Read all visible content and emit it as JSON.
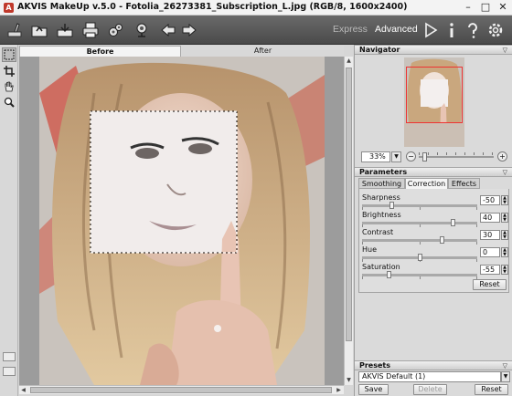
{
  "window": {
    "title": "AKVIS MakeUp v.5.0 - Fotolia_26273381_Subscription_L.jpg (RGB/8, 1600x2400)",
    "logo_letter": "A",
    "minimize": "–",
    "maximize": "□",
    "close": "✕"
  },
  "toolbar": {
    "icons": [
      "open-image-icon",
      "save-image-icon",
      "print-icon",
      "plugins-icon",
      "batch-icon",
      "undo-icon",
      "redo-icon",
      "run-icon",
      "info-icon",
      "help-icon",
      "preferences-icon"
    ],
    "mode_express": "Express",
    "mode_advanced": "Advanced",
    "active_mode": "Advanced"
  },
  "left_tools": [
    "selection-tool-icon",
    "crop-tool-icon",
    "hand-tool-icon",
    "zoom-tool-icon"
  ],
  "canvas": {
    "tab_before": "Before",
    "tab_after": "After",
    "active_tab": "Before"
  },
  "navigator": {
    "title": "Navigator",
    "zoom_value": "33%",
    "zoom_minus": "−",
    "zoom_plus": "+"
  },
  "parameters": {
    "title": "Parameters",
    "tabs": [
      "Smoothing",
      "Correction",
      "Effects"
    ],
    "active_tab": "Correction",
    "items": [
      {
        "label": "Sharpness",
        "value": "-50",
        "fraction": 0.25
      },
      {
        "label": "Brightness",
        "value": "40",
        "fraction": 0.8
      },
      {
        "label": "Contrast",
        "value": "30",
        "fraction": 0.7
      },
      {
        "label": "Hue",
        "value": "0",
        "fraction": 0.5
      },
      {
        "label": "Saturation",
        "value": "-55",
        "fraction": 0.22
      }
    ],
    "reset_label": "Reset"
  },
  "presets": {
    "title": "Presets",
    "selected": "AKVIS Default (1)",
    "save_label": "Save",
    "delete_label": "Delete",
    "reset_label": "Reset"
  },
  "colors": {
    "toolbar_bg": "#555555",
    "active_mode": "#ffffff",
    "inactive_mode": "#b9b9b9",
    "logo": "#c0392b"
  }
}
